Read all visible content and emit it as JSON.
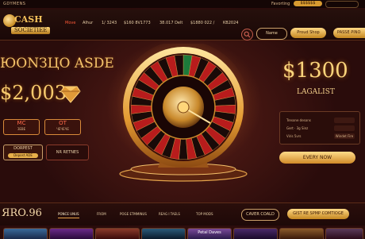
{
  "topbar": {
    "brand": "GDYMENS",
    "favorites": "Favorting",
    "account": "$$$$$$",
    "user": ""
  },
  "logo": {
    "line1": "CASH",
    "line2": "SOCIETIEE"
  },
  "nav": [
    {
      "label": "Move",
      "active": true
    },
    {
      "label": "Alhur",
      "active": false
    },
    {
      "label": "1/ 3243",
      "active": false
    },
    {
      "label": "$160 8V1773",
      "active": false
    },
    {
      "label": "38.017 Delt",
      "active": false
    },
    {
      "label": "$1880 022 /",
      "active": false
    },
    {
      "label": "KB2024",
      "active": false
    }
  ],
  "header_buttons": {
    "name": "Name",
    "shop": "Proud Shop",
    "pass": "PASSE PINO"
  },
  "hero": {
    "title": "ЮОNЗЦО ASDE",
    "amount": "$2,003",
    "stats": [
      {
        "value": "MC",
        "label": "ЗЕВЕ"
      },
      {
        "value": "OT",
        "label": "ЧЕЧЕЧЕ"
      }
    ],
    "deposit_label": "DORPEST",
    "deposit_sub": "Depost ADE",
    "retry_label": "NR RETNES"
  },
  "jackpot": {
    "amount": "$1300",
    "label": "LAGALIST",
    "rows": [
      {
        "label": "Tresone desons",
        "value": ""
      },
      {
        "label": "Gert · 3g Sinz",
        "value": ""
      },
      {
        "label": "Viris 5vrs",
        "value": "Windet Fire"
      }
    ],
    "cta": "EVERY NOW"
  },
  "bottom": {
    "title": "ЯRO.96",
    "tabs": [
      {
        "label": "PONCE UNUS",
        "active": true
      },
      {
        "label": "FROM",
        "active": false
      },
      {
        "label": "POGE ETMMINUS",
        "active": false
      },
      {
        "label": "REAG I TAELS",
        "active": false
      },
      {
        "label": "TOP MODS",
        "active": false
      }
    ],
    "cover_label": "CAVER COALD",
    "get_label": "GIST RE SPMP COMTIOGE"
  },
  "thumbs": [
    "",
    "",
    "",
    "",
    "Petal Daves",
    "",
    "",
    ""
  ],
  "colors": {
    "accent": "#d89a30",
    "active_nav": "#ff5a38",
    "background": "#2a0d0c"
  }
}
